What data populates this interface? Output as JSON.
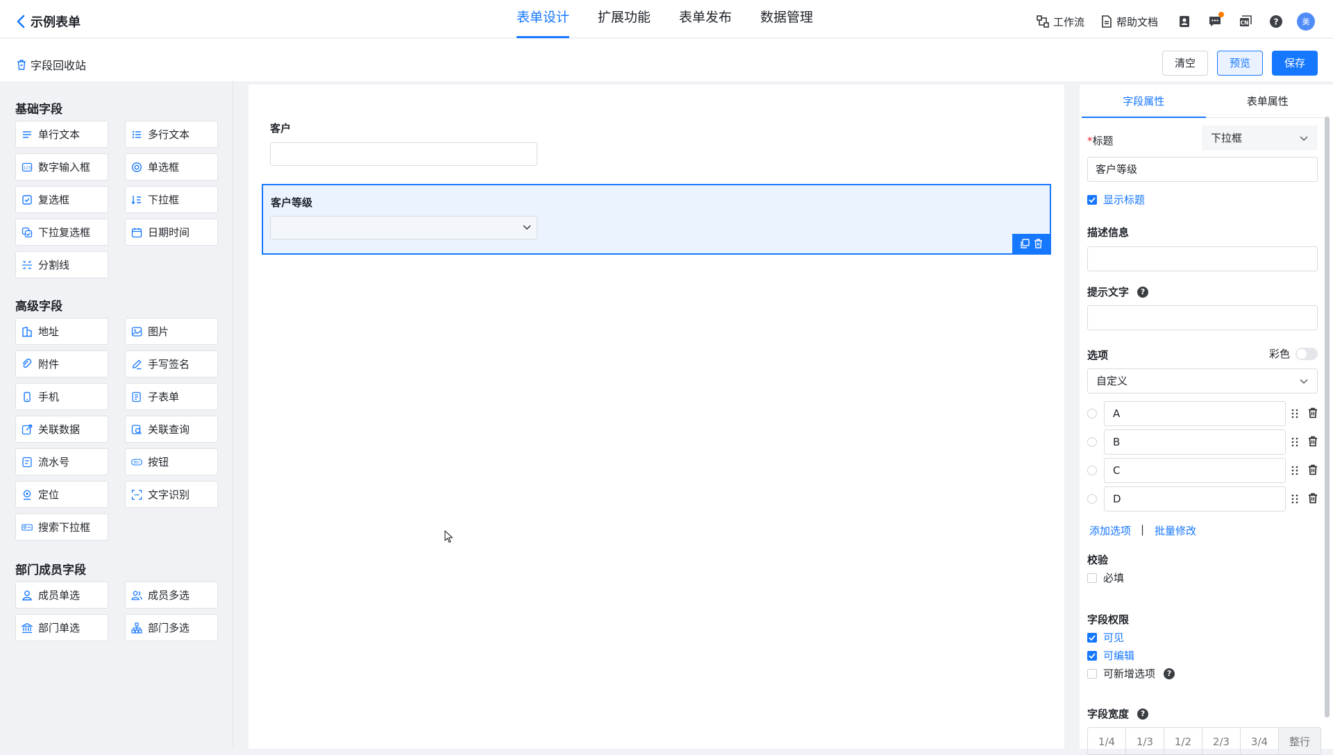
{
  "header": {
    "back_title": "示例表单",
    "tabs": [
      {
        "label": "表单设计",
        "active": true
      },
      {
        "label": "扩展功能",
        "active": false
      },
      {
        "label": "表单发布",
        "active": false
      },
      {
        "label": "数据管理",
        "active": false
      }
    ],
    "workflow_label": "工作流",
    "help_doc_label": "帮助文档",
    "avatar_text": "美"
  },
  "toolbar": {
    "recycle_label": "字段回收站",
    "clear_label": "清空",
    "preview_label": "预览",
    "save_label": "保存"
  },
  "palette": {
    "basic": {
      "title": "基础字段",
      "items": [
        {
          "label": "单行文本",
          "icon": "single-line-text-icon"
        },
        {
          "label": "多行文本",
          "icon": "multi-line-text-icon"
        },
        {
          "label": "数字输入框",
          "icon": "number-input-icon"
        },
        {
          "label": "单选框",
          "icon": "radio-icon"
        },
        {
          "label": "复选框",
          "icon": "checkbox-icon"
        },
        {
          "label": "下拉框",
          "icon": "dropdown-icon"
        },
        {
          "label": "下拉复选框",
          "icon": "dropdown-checkbox-icon"
        },
        {
          "label": "日期时间",
          "icon": "calendar-icon"
        },
        {
          "label": "分割线",
          "icon": "divider-icon"
        }
      ]
    },
    "advanced": {
      "title": "高级字段",
      "items": [
        {
          "label": "地址",
          "icon": "address-icon"
        },
        {
          "label": "图片",
          "icon": "image-icon"
        },
        {
          "label": "附件",
          "icon": "attachment-icon"
        },
        {
          "label": "手写签名",
          "icon": "signature-icon"
        },
        {
          "label": "手机",
          "icon": "phone-icon"
        },
        {
          "label": "子表单",
          "icon": "subform-icon"
        },
        {
          "label": "关联数据",
          "icon": "linked-data-icon"
        },
        {
          "label": "关联查询",
          "icon": "linked-query-icon"
        },
        {
          "label": "流水号",
          "icon": "serial-number-icon"
        },
        {
          "label": "按钮",
          "icon": "button-icon"
        },
        {
          "label": "定位",
          "icon": "location-icon"
        },
        {
          "label": "文字识别",
          "icon": "ocr-icon"
        },
        {
          "label": "搜索下拉框",
          "icon": "search-dropdown-icon"
        }
      ]
    },
    "member": {
      "title": "部门成员字段",
      "items": [
        {
          "label": "成员单选",
          "icon": "member-single-icon"
        },
        {
          "label": "成员多选",
          "icon": "member-multi-icon"
        },
        {
          "label": "部门单选",
          "icon": "department-single-icon"
        },
        {
          "label": "部门多选",
          "icon": "department-multi-icon"
        }
      ]
    }
  },
  "canvas": {
    "fields": [
      {
        "label": "客户",
        "type": "text",
        "value": ""
      },
      {
        "label": "客户等级",
        "type": "dropdown",
        "value": "",
        "selected": true
      }
    ]
  },
  "properties": {
    "tabs": [
      {
        "label": "字段属性",
        "active": true
      },
      {
        "label": "表单属性",
        "active": false
      }
    ],
    "title_label": "标题",
    "required_mark": "*",
    "field_type": "下拉框",
    "title_value": "客户等级",
    "show_title_label": "显示标题",
    "show_title_checked": true,
    "description_label": "描述信息",
    "description_value": "",
    "hint_label": "提示文字",
    "hint_value": "",
    "options_label": "选项",
    "color_label": "彩色",
    "color_on": false,
    "options_source": "自定义",
    "options": [
      "A",
      "B",
      "C",
      "D"
    ],
    "add_option": "添加选项",
    "separator": "|",
    "batch_edit": "批量修改",
    "validation_label": "校验",
    "required_label": "必填",
    "required_checked": false,
    "permission_label": "字段权限",
    "visible_label": "可见",
    "visible_checked": true,
    "editable_label": "可编辑",
    "editable_checked": true,
    "allow_new_label": "可新增选项",
    "allow_new_checked": false,
    "width_label": "字段宽度",
    "width_options": [
      "1/4",
      "1/3",
      "1/2",
      "2/3",
      "3/4",
      "整行"
    ],
    "help_glyph": "?"
  },
  "colors": {
    "accent": "#1677ff",
    "selected_bg": "#ebf3ff",
    "notification_dot": "#ff7a00"
  }
}
